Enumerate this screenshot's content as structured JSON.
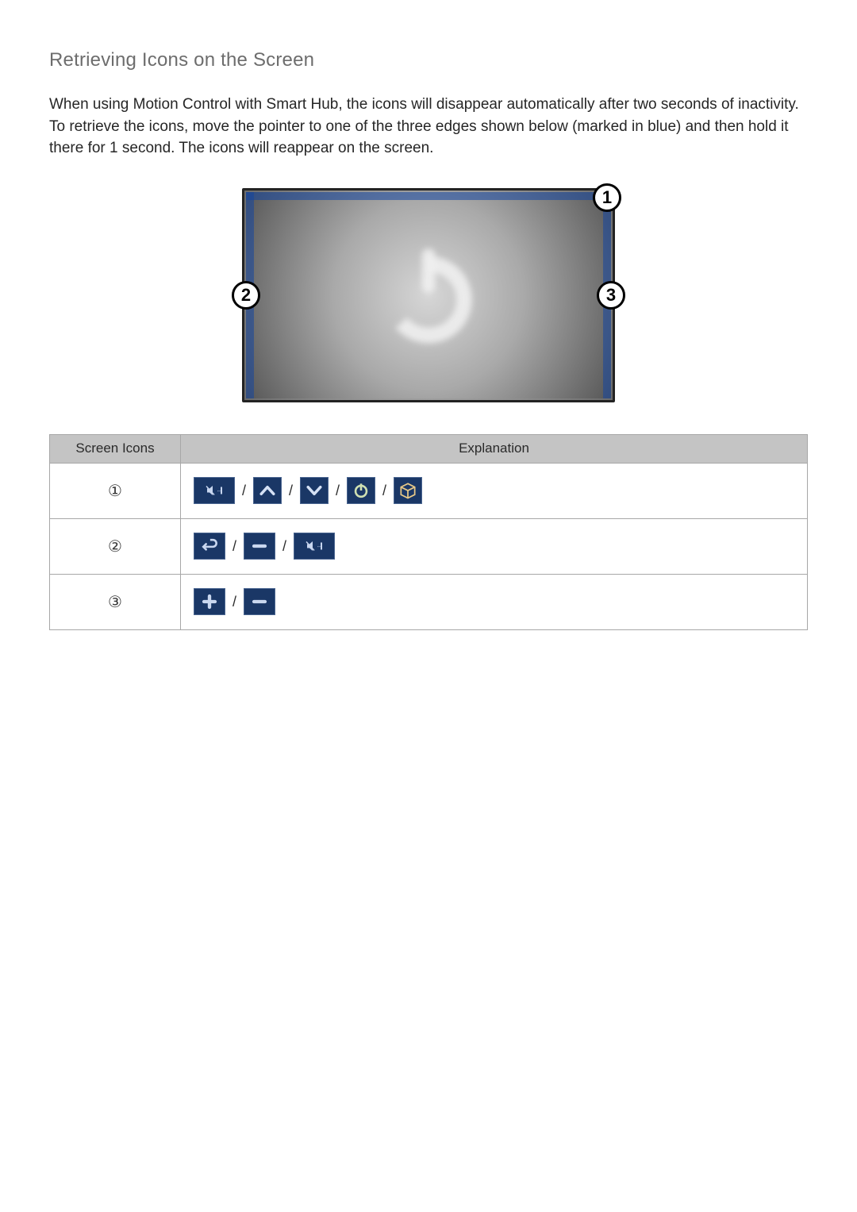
{
  "title": "Retrieving Icons on the Screen",
  "body": "When using Motion Control with Smart Hub, the icons will disappear automatically after two seconds of inactivity. To retrieve the icons, move the pointer to one of the three edges shown below (marked in blue) and then hold it there for 1 second. The icons will reappear on the screen.",
  "markers": {
    "m1": "1",
    "m2": "2",
    "m3": "3"
  },
  "table": {
    "headers": {
      "col1": "Screen Icons",
      "col2": "Explanation"
    },
    "rows": {
      "r1": "①",
      "r2": "②",
      "r3": "③"
    },
    "sep": "/"
  }
}
